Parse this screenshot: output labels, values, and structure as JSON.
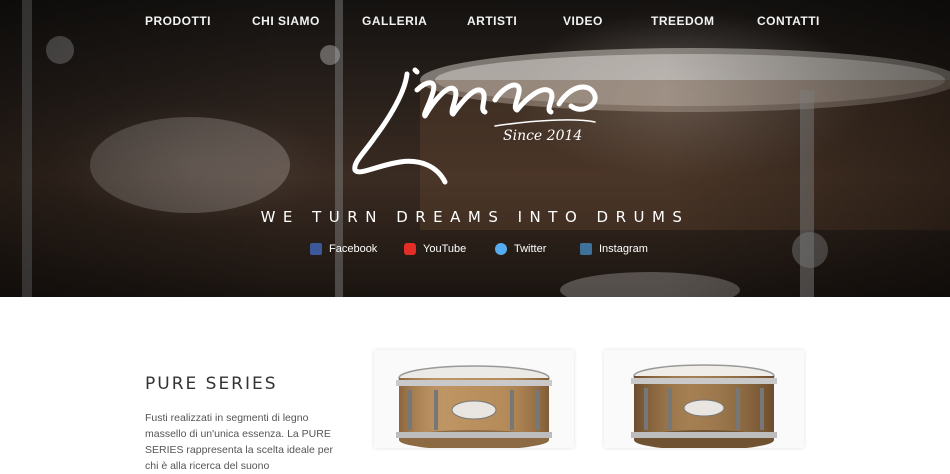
{
  "nav": {
    "items": [
      "PRODOTTI",
      "CHI SIAMO",
      "GALLERIA",
      "ARTISTI",
      "VIDEO",
      "TREEDOM",
      "CONTATTI"
    ]
  },
  "hero": {
    "logo_text": "imma",
    "logo_since": "Since 2014",
    "tagline": "WE TURN DREAMS INTO DRUMS"
  },
  "social": [
    {
      "label": "Facebook",
      "icon": "facebook-icon",
      "color": "#3b5998"
    },
    {
      "label": "YouTube",
      "icon": "youtube-icon",
      "color": "#e52d27"
    },
    {
      "label": "Twitter",
      "icon": "twitter-icon",
      "color": "#55acee"
    },
    {
      "label": "Instagram",
      "icon": "instagram-icon",
      "color": "#3f729b"
    }
  ],
  "series": {
    "title": "PURE SERIES",
    "text": "Fusti realizzati in segmenti di legno massello di un'unica essenza. La PURE SERIES rappresenta la scelta ideale per chi è alla ricerca del suono"
  }
}
